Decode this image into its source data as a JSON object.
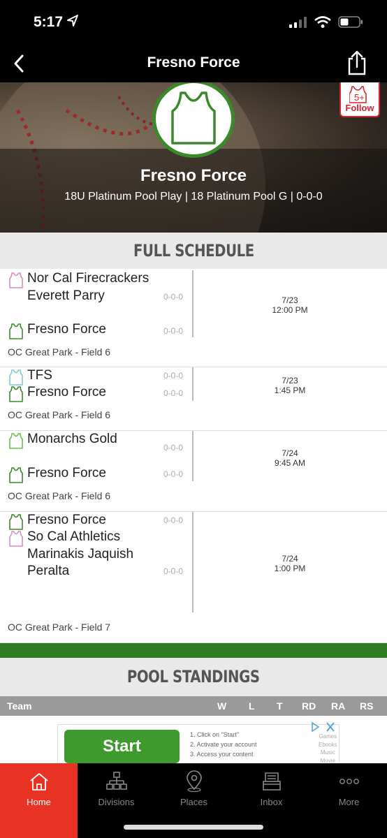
{
  "status": {
    "time": "5:17"
  },
  "nav": {
    "title": "Fresno Force"
  },
  "hero": {
    "follow_count": "5+",
    "follow_label": "Follow",
    "team_name": "Fresno Force",
    "subtitle": "18U Platinum Pool Play | 18 Platinum Pool G | 0-0-0"
  },
  "schedule": {
    "title": "FULL SCHEDULE",
    "games": [
      {
        "away": {
          "name": "Nor Cal Firecrackers Everett Parry",
          "record": "0-0-0",
          "jersey_color": "#d98bc4"
        },
        "home": {
          "name": "Fresno Force",
          "record": "0-0-0",
          "jersey_color": "#3a8a2a"
        },
        "date": "7/23",
        "time": "12:00 PM",
        "venue": "OC Great Park - Field 6"
      },
      {
        "away": {
          "name": "TFS",
          "record": "0-0-0",
          "jersey_color": "#7fc9dc"
        },
        "home": {
          "name": "Fresno Force",
          "record": "0-0-0",
          "jersey_color": "#3a8a2a"
        },
        "date": "7/23",
        "time": "1:45 PM",
        "venue": "OC Great Park - Field 6"
      },
      {
        "away": {
          "name": "Monarchs Gold",
          "record": "0-0-0",
          "jersey_color": "#6ac04a"
        },
        "home": {
          "name": "Fresno Force",
          "record": "0-0-0",
          "jersey_color": "#3a8a2a"
        },
        "date": "7/24",
        "time": "9:45 AM",
        "venue": "OC Great Park - Field 6"
      },
      {
        "away": {
          "name": "Fresno Force",
          "record": "0-0-0",
          "jersey_color": "#3a8a2a"
        },
        "home": {
          "name": "So Cal Athletics Marinakis Jaquish Peralta",
          "record": "0-0-0",
          "jersey_color": "#d98bc4"
        },
        "date": "7/24",
        "time": "1:00 PM",
        "venue": "OC Great Park - Field 7"
      }
    ]
  },
  "standings": {
    "title": "POOL STANDINGS",
    "columns": [
      "Team",
      "W",
      "L",
      "T",
      "RD",
      "RA",
      "RS"
    ]
  },
  "ad": {
    "button_label": "Start",
    "steps": [
      "1. Click on \"Start\"",
      "2. Activate your account",
      "3. Access your content"
    ],
    "categories": [
      "Games",
      "Ebooks",
      "Music",
      "Movie"
    ]
  },
  "tabs": [
    {
      "label": "Home",
      "icon": "home-icon",
      "active": true
    },
    {
      "label": "Divisions",
      "icon": "divisions-icon"
    },
    {
      "label": "Places",
      "icon": "places-icon"
    },
    {
      "label": "Inbox",
      "icon": "inbox-icon"
    },
    {
      "label": "More",
      "icon": "more-icon"
    }
  ],
  "colors": {
    "accent_green": "#3a8a2a",
    "tab_active": "#e83324",
    "follow_red": "#d7262e"
  }
}
